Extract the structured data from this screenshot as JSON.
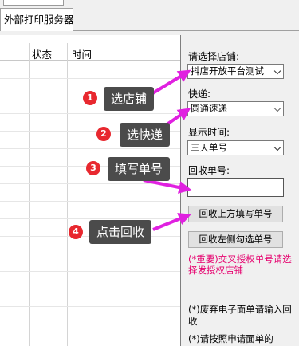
{
  "tabs": {
    "active": "外部打印服务器"
  },
  "grid": {
    "columns": [
      "状态",
      "时间"
    ]
  },
  "form": {
    "shop_label": "请选择店铺:",
    "shop_value": "抖店开放平台测试",
    "express_label": "快递:",
    "express_value": "圆通速递",
    "time_label": "显示时间:",
    "time_value": "三天单号",
    "recycle_label": "回收单号:",
    "recycle_value": "",
    "btn_fill_above": "回收上方填写单号",
    "btn_left_checked": "回收左侧勾选单号",
    "warning": "(*重要)交叉授权单号请选择发授权店铺",
    "note1": "(*)废弃电子面单请输入回收",
    "note2": "(*)请按照申请面单的"
  },
  "callouts": [
    {
      "num": "1",
      "text": "选店铺"
    },
    {
      "num": "2",
      "text": "选快递"
    },
    {
      "num": "3",
      "text": "填写单号"
    },
    {
      "num": "4",
      "text": "点击回收"
    }
  ],
  "colors": {
    "arrow": "#e020e0",
    "warning": "#e6006e",
    "callout_bg": "#4b4b4b",
    "badge": "#e8282f"
  }
}
